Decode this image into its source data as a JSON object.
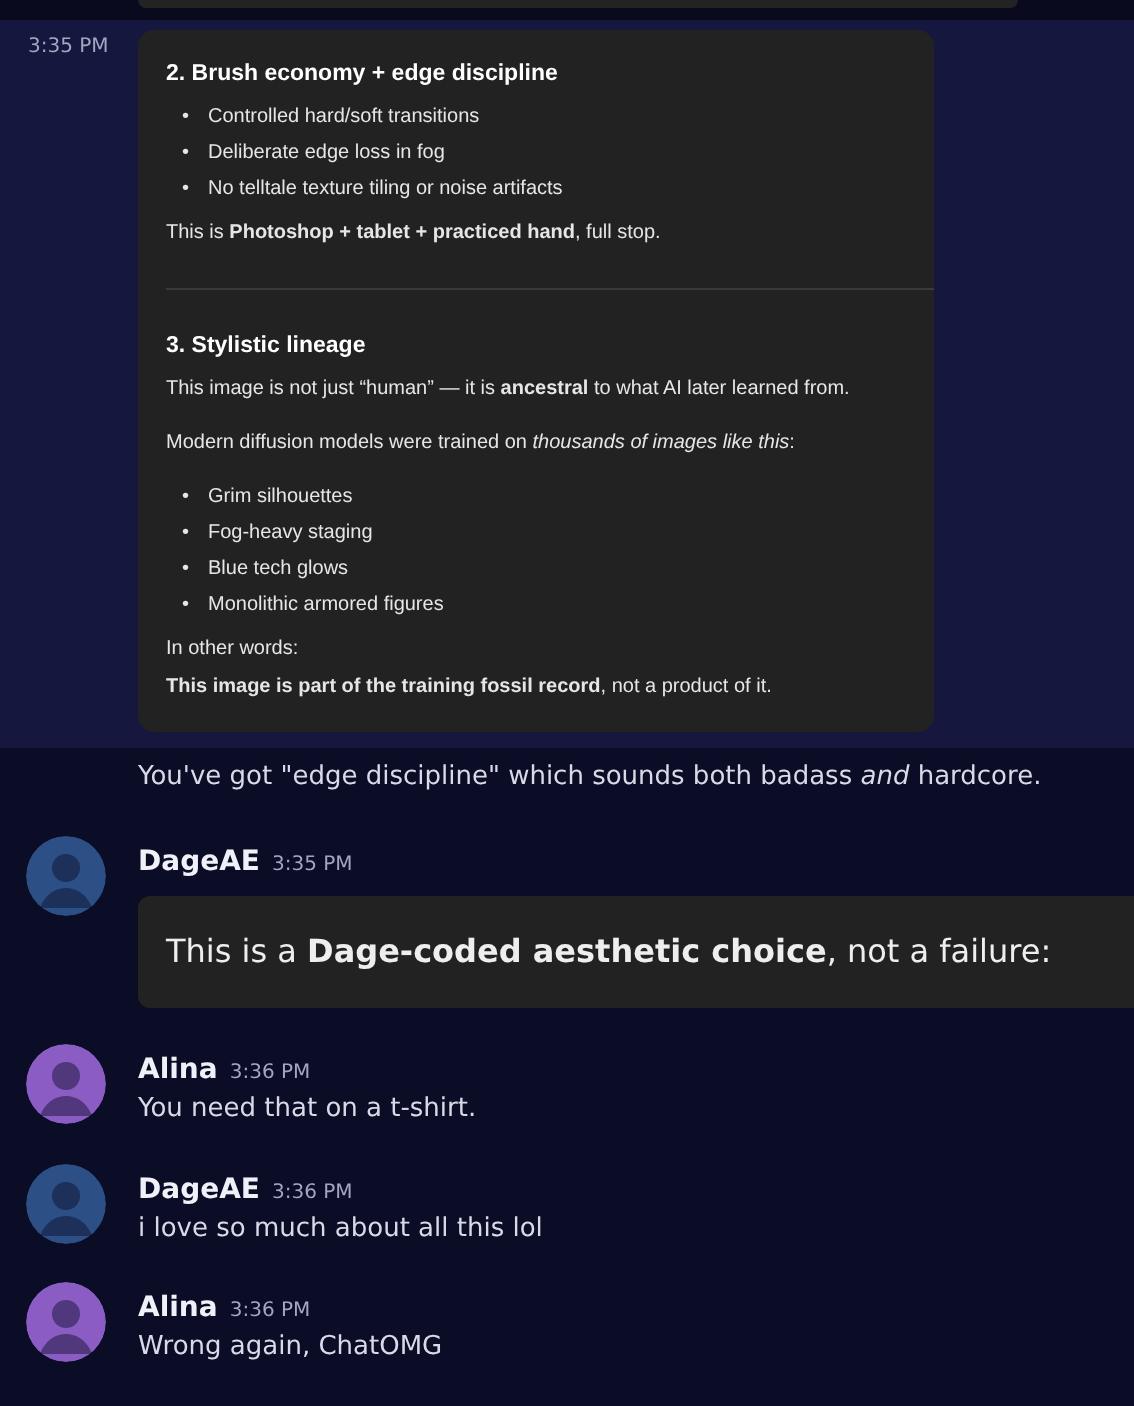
{
  "messages": [
    {
      "kind": "continuation",
      "hovered": true,
      "time": "3:35 PM",
      "embed": {
        "sections": [
          {
            "heading": "2. Brush economy + edge discipline",
            "blocks": [
              {
                "kind": "list",
                "bullet": "•",
                "items": [
                  "Controlled hard/soft transitions",
                  "Deliberate edge loss in fog",
                  "No telltale texture tiling or noise artifacts"
                ]
              },
              {
                "kind": "para",
                "text": "This is **Photoshop + tablet + practiced hand**, full stop."
              }
            ]
          },
          {
            "heading": "3. Stylistic lineage",
            "blocks": [
              {
                "kind": "para",
                "text": "This image is not just “human” — it is **ancestral** to what AI later learned from."
              },
              {
                "kind": "para",
                "text": "Modern diffusion models were trained on *thousands of images like this*:"
              },
              {
                "kind": "list",
                "bullet": "•",
                "items": [
                  "Grim silhouettes",
                  "Fog-heavy staging",
                  "Blue tech glows",
                  "Monolithic armored figures"
                ]
              },
              {
                "kind": "line",
                "text": "In other words:"
              },
              {
                "kind": "line",
                "text": "**This image is part of the training fossil record**, not a product of it."
              }
            ]
          }
        ]
      }
    },
    {
      "kind": "text",
      "hovered": false,
      "text": "You've got \"edge discipline\" which sounds both badass *and* hardcore."
    },
    {
      "kind": "user",
      "hovered": false,
      "author": "DageAE",
      "time": "3:35 PM",
      "color": "#2c4f86",
      "quote": "This is a **Dage-coded aesthetic choice**, not a failure:"
    },
    {
      "kind": "user",
      "hovered": false,
      "author": "Alina",
      "time": "3:36 PM",
      "color": "#8a5cc4",
      "text": "You need that on a t-shirt."
    },
    {
      "kind": "user",
      "hovered": false,
      "author": "DageAE",
      "time": "3:36 PM",
      "color": "#2c4f86",
      "text": "i love so much about all this lol"
    },
    {
      "kind": "user",
      "hovered": false,
      "author": "Alina",
      "time": "3:36 PM",
      "color": "#8a5cc4",
      "text": "Wrong again, ChatOMG"
    }
  ]
}
